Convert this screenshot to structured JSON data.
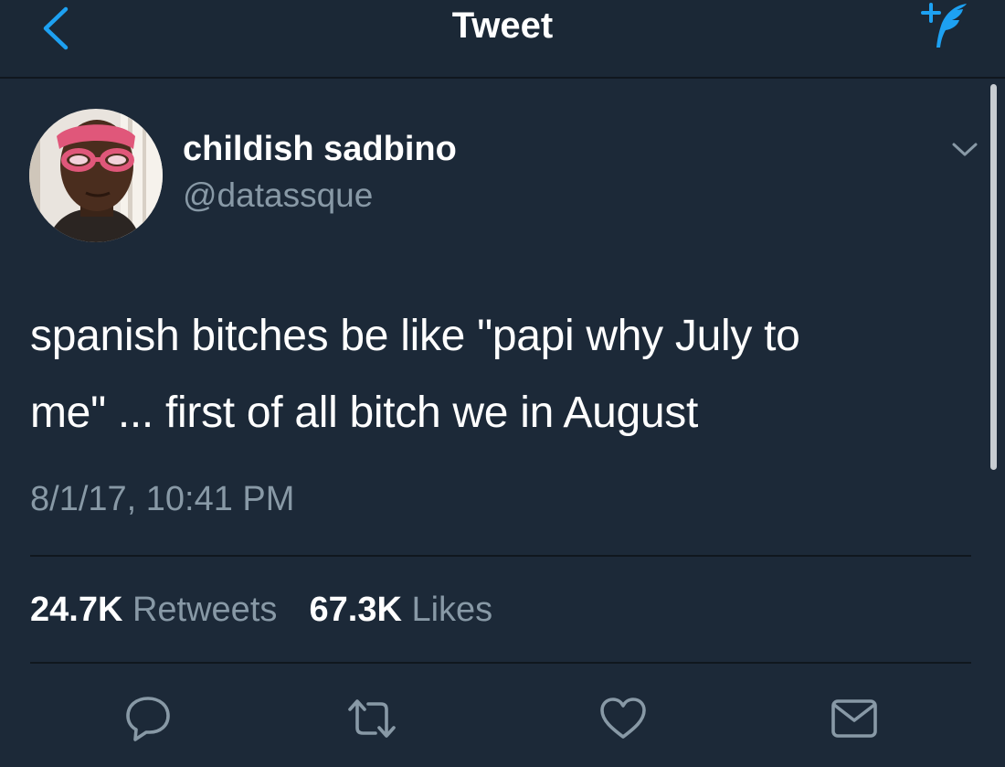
{
  "navbar": {
    "title": "Tweet",
    "back_icon": "chevron-left-icon",
    "compose_icon": "compose-tweet-icon",
    "accent_color": "#1da1f2"
  },
  "tweet": {
    "author": {
      "display_name": "childish sadbino",
      "handle": "@datassque"
    },
    "text_line_1": "spanish bitches be like \"papi why July to",
    "text_line_2": "me\" ... first of all bitch we in August",
    "timestamp": "8/1/17, 10:41 PM",
    "stats": {
      "retweets_count": "24.7K",
      "retweets_label": "Retweets",
      "likes_count": "67.3K",
      "likes_label": "Likes"
    }
  },
  "actions": [
    "reply-icon",
    "retweet-icon",
    "like-icon",
    "direct-message-icon"
  ],
  "colors": {
    "background": "#1c2938",
    "secondary_text": "#8899a6",
    "primary_text": "#ffffff"
  }
}
